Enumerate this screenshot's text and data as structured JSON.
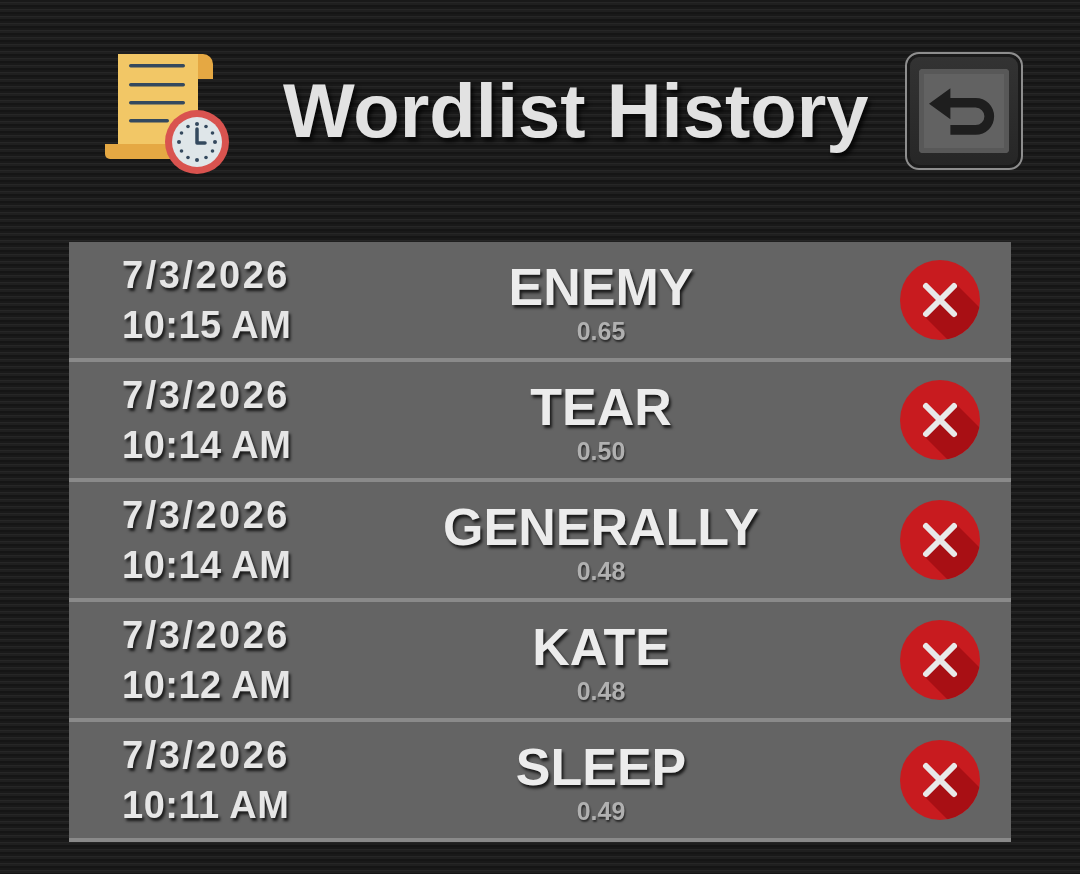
{
  "header": {
    "title": "Wordlist History"
  },
  "history": [
    {
      "date": "7/3/2026",
      "time": "10:15 AM",
      "word": "ENEMY",
      "score": "0.65"
    },
    {
      "date": "7/3/2026",
      "time": "10:14 AM",
      "word": "TEAR",
      "score": "0.50"
    },
    {
      "date": "7/3/2026",
      "time": "10:14 AM",
      "word": "GENERALLY",
      "score": "0.48"
    },
    {
      "date": "7/3/2026",
      "time": "10:12 AM",
      "word": "KATE",
      "score": "0.48"
    },
    {
      "date": "7/3/2026",
      "time": "10:11 AM",
      "word": "SLEEP",
      "score": "0.49"
    }
  ]
}
